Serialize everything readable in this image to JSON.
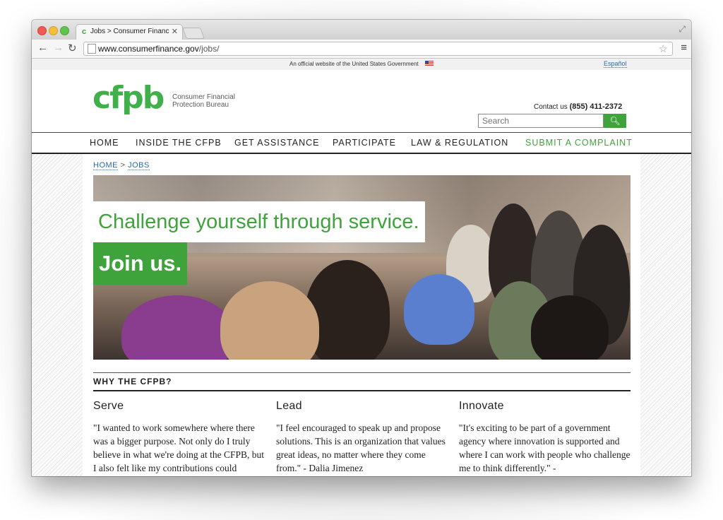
{
  "browser": {
    "tab_title": "Jobs > Consumer Financia",
    "tab_favicon": "c",
    "url_domain": "www.consumerfinance.gov",
    "url_path": "/jobs/"
  },
  "gov_banner": {
    "text": "An official website of the United States Government",
    "language_link": "Español"
  },
  "header": {
    "logo_text": "cfpb",
    "logo_subtitle_1": "Consumer Financial",
    "logo_subtitle_2": "Protection Bureau",
    "contact_label": "Contact us",
    "contact_phone": "(855) 411-2372",
    "search_placeholder": "Search"
  },
  "nav": {
    "items": [
      "HOME",
      "INSIDE THE CFPB",
      "GET ASSISTANCE",
      "PARTICIPATE",
      "LAW & REGULATION",
      "SUBMIT A COMPLAINT"
    ]
  },
  "breadcrumb": {
    "home": "HOME",
    "separator": ">",
    "current": "JOBS"
  },
  "hero": {
    "line1": "Challenge yourself through service.",
    "line2": "Join us."
  },
  "why": {
    "title": "WHY THE CFPB?",
    "columns": [
      {
        "heading": "Serve",
        "quote": "\"I wanted to work somewhere where there was a bigger purpose. Not only do I truly believe in what we're doing at the CFPB, but I also felt like my contributions could"
      },
      {
        "heading": "Lead",
        "quote": "\"I feel encouraged to speak up and propose solutions. This is an organization that values great ideas, no matter where they come from.\" - Dalia Jimenez"
      },
      {
        "heading": "Innovate",
        "quote": "\"It's exciting to be part of a government agency where innovation is supported and where I can work with people who challenge me to think differently.\" -"
      }
    ]
  },
  "colors": {
    "brand_green": "#3fa33c",
    "link_blue": "#2a6aa8"
  }
}
